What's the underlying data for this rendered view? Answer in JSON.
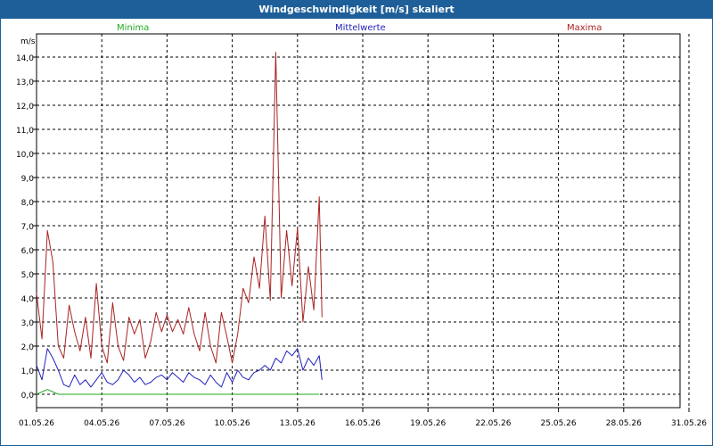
{
  "window": {
    "title": "Windgeschwindigkeit [m/s] skaliert"
  },
  "legend": [
    {
      "label": "Minima",
      "color": "#22aa22"
    },
    {
      "label": "Mittelwerte",
      "color": "#2222bb"
    },
    {
      "label": "Maxima",
      "color": "#aa2222"
    }
  ],
  "chart_data": {
    "type": "line",
    "title": "Windgeschwindigkeit [m/s] skaliert",
    "ylabel": "m/s",
    "xlabel": "",
    "ylim": [
      -0.5,
      15
    ],
    "xlim": [
      "01.05.26",
      "01.06.26"
    ],
    "y_ticks": [
      "0,0",
      "1,0",
      "2,0",
      "3,0",
      "4,0",
      "5,0",
      "6,0",
      "7,0",
      "8,0",
      "9,0",
      "10,0",
      "11,0",
      "12,0",
      "13,0",
      "14,0"
    ],
    "x_ticks": [
      "01.05.26",
      "04.05.26",
      "07.05.26",
      "10.05.26",
      "13.05.26",
      "16.05.26",
      "19.05.26",
      "22.05.26",
      "25.05.26",
      "28.05.26",
      "31.05.26"
    ],
    "grid": true,
    "legend_position": "top",
    "series": [
      {
        "name": "Minima",
        "color": "#22aa22",
        "x": [
          "01.05.26",
          "01.05.26 12:00",
          "02.05.26",
          "03.05.26",
          "05.05.26",
          "07.05.26",
          "09.05.26",
          "11.05.26",
          "12.05.26",
          "13.05.26",
          "13.05.26 18:00",
          "14.05.26"
        ],
        "y": [
          0,
          0.2,
          0,
          0,
          0,
          0,
          0,
          0,
          0,
          0,
          0,
          0
        ]
      },
      {
        "name": "Mittelwerte",
        "color": "#2222bb",
        "x": [
          "01.05.26",
          "01.05.26 06:00",
          "01.05.26 12:00",
          "01.05.26 18:00",
          "02.05.26",
          "02.05.26 06:00",
          "02.05.26 12:00",
          "02.05.26 18:00",
          "03.05.26",
          "03.05.26 06:00",
          "03.05.26 12:00",
          "03.05.26 18:00",
          "04.05.26",
          "04.05.26 06:00",
          "04.05.26 12:00",
          "04.05.26 18:00",
          "05.05.26",
          "05.05.26 06:00",
          "05.05.26 12:00",
          "05.05.26 18:00",
          "06.05.26",
          "06.05.26 06:00",
          "06.05.26 12:00",
          "06.05.26 18:00",
          "07.05.26",
          "07.05.26 06:00",
          "07.05.26 12:00",
          "07.05.26 18:00",
          "08.05.26",
          "08.05.26 06:00",
          "08.05.26 12:00",
          "08.05.26 18:00",
          "09.05.26",
          "09.05.26 06:00",
          "09.05.26 12:00",
          "09.05.26 18:00",
          "10.05.26",
          "10.05.26 06:00",
          "10.05.26 12:00",
          "10.05.26 18:00",
          "11.05.26",
          "11.05.26 06:00",
          "11.05.26 12:00",
          "11.05.26 18:00",
          "12.05.26",
          "12.05.26 06:00",
          "12.05.26 12:00",
          "12.05.26 18:00",
          "13.05.26",
          "13.05.26 06:00",
          "13.05.26 12:00",
          "13.05.26 18:00",
          "14.05.26",
          "14.05.26 03:00"
        ],
        "y": [
          1.2,
          0.6,
          1.9,
          1.5,
          1.0,
          0.4,
          0.3,
          0.8,
          0.4,
          0.6,
          0.3,
          0.6,
          0.9,
          0.5,
          0.4,
          0.6,
          1.0,
          0.8,
          0.5,
          0.7,
          0.4,
          0.5,
          0.7,
          0.8,
          0.6,
          0.9,
          0.7,
          0.5,
          0.9,
          0.7,
          0.6,
          0.4,
          0.8,
          0.5,
          0.3,
          0.9,
          0.5,
          1.0,
          0.7,
          0.6,
          0.9,
          1.0,
          1.2,
          1.0,
          1.5,
          1.3,
          1.8,
          1.6,
          1.9,
          1.0,
          1.5,
          1.2,
          1.6,
          0.6
        ]
      },
      {
        "name": "Maxima",
        "color": "#aa2222",
        "x": [
          "01.05.26",
          "01.05.26 06:00",
          "01.05.26 12:00",
          "01.05.26 18:00",
          "02.05.26",
          "02.05.26 06:00",
          "02.05.26 12:00",
          "02.05.26 18:00",
          "03.05.26",
          "03.05.26 06:00",
          "03.05.26 12:00",
          "03.05.26 18:00",
          "04.05.26",
          "04.05.26 06:00",
          "04.05.26 12:00",
          "04.05.26 18:00",
          "05.05.26",
          "05.05.26 06:00",
          "05.05.26 12:00",
          "05.05.26 18:00",
          "06.05.26",
          "06.05.26 06:00",
          "06.05.26 12:00",
          "06.05.26 18:00",
          "07.05.26",
          "07.05.26 06:00",
          "07.05.26 12:00",
          "07.05.26 18:00",
          "08.05.26",
          "08.05.26 06:00",
          "08.05.26 12:00",
          "08.05.26 18:00",
          "09.05.26",
          "09.05.26 06:00",
          "09.05.26 12:00",
          "09.05.26 18:00",
          "10.05.26",
          "10.05.26 06:00",
          "10.05.26 12:00",
          "10.05.26 18:00",
          "11.05.26",
          "11.05.26 06:00",
          "11.05.26 12:00",
          "11.05.26 18:00",
          "12.05.26",
          "12.05.26 06:00",
          "12.05.26 12:00",
          "12.05.26 18:00",
          "13.05.26",
          "13.05.26 06:00",
          "13.05.26 12:00",
          "13.05.26 18:00",
          "14.05.26",
          "14.05.26 03:00"
        ],
        "y": [
          4.2,
          2.3,
          6.8,
          5.5,
          2.0,
          1.5,
          3.7,
          2.6,
          1.8,
          3.2,
          1.5,
          4.6,
          2.0,
          1.3,
          3.8,
          2.0,
          1.4,
          3.2,
          2.5,
          3.1,
          1.5,
          2.2,
          3.4,
          2.6,
          3.3,
          2.6,
          3.1,
          2.5,
          3.6,
          2.5,
          1.8,
          3.4,
          2.0,
          1.3,
          3.4,
          2.4,
          1.3,
          2.5,
          4.4,
          3.8,
          5.7,
          4.4,
          7.4,
          3.9,
          14.2,
          4.0,
          6.8,
          4.5,
          6.9,
          3.0,
          5.3,
          3.5,
          8.2,
          3.2
        ]
      }
    ]
  }
}
